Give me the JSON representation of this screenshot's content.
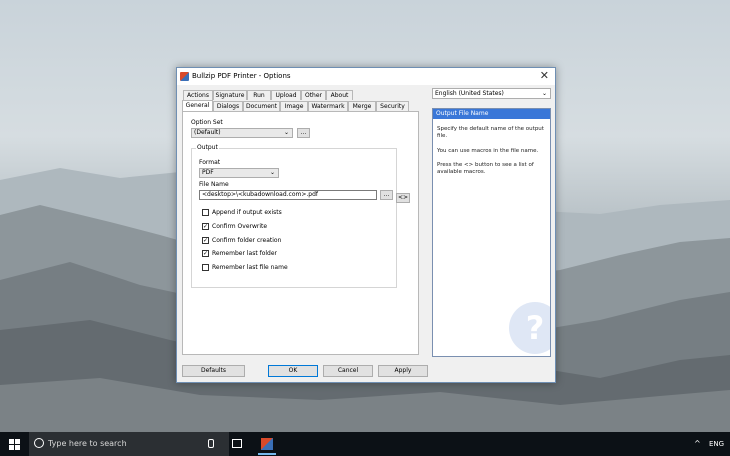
{
  "window": {
    "title": "Bullzip PDF Printer - Options",
    "close_glyph": "✕"
  },
  "tabs": {
    "row1": [
      "Actions",
      "Signature",
      "Run",
      "Upload",
      "Other",
      "About"
    ],
    "row2": [
      "General",
      "Dialogs",
      "Document",
      "Image",
      "Watermark",
      "Merge",
      "Security"
    ],
    "active": "General"
  },
  "general": {
    "option_set_label": "Option Set",
    "option_set_value": "(Default)",
    "browse_label": "...",
    "output_group_label": "Output",
    "format_label": "Format",
    "format_value": "PDF",
    "file_name_label": "File Name",
    "file_name_value": "<desktop>\\<kubadownload.com>.pdf",
    "file_browse_label": "...",
    "macro_button_label": "<>",
    "checkboxes": [
      {
        "label": "Append if output exists",
        "checked": false
      },
      {
        "label": "Confirm Overwrite",
        "checked": true
      },
      {
        "label": "Confirm folder creation",
        "checked": true
      },
      {
        "label": "Remember last folder",
        "checked": true
      },
      {
        "label": "Remember last file name",
        "checked": false
      }
    ]
  },
  "language": {
    "value": "English (United States)"
  },
  "help": {
    "header": "Output File Name",
    "paragraphs": [
      "Specify the default name of the output file.",
      "You can use macros in the file name.",
      "Press the <> button to see a list of available macros."
    ],
    "watermark_glyph": "?"
  },
  "buttons": {
    "defaults": "Defaults",
    "ok": "OK",
    "cancel": "Cancel",
    "apply": "Apply"
  },
  "taskbar": {
    "search_placeholder": "Type here to search",
    "chevron": "^",
    "lang": "ENG"
  },
  "glyphs": {
    "dropdown": "⌄",
    "check": "✓"
  }
}
